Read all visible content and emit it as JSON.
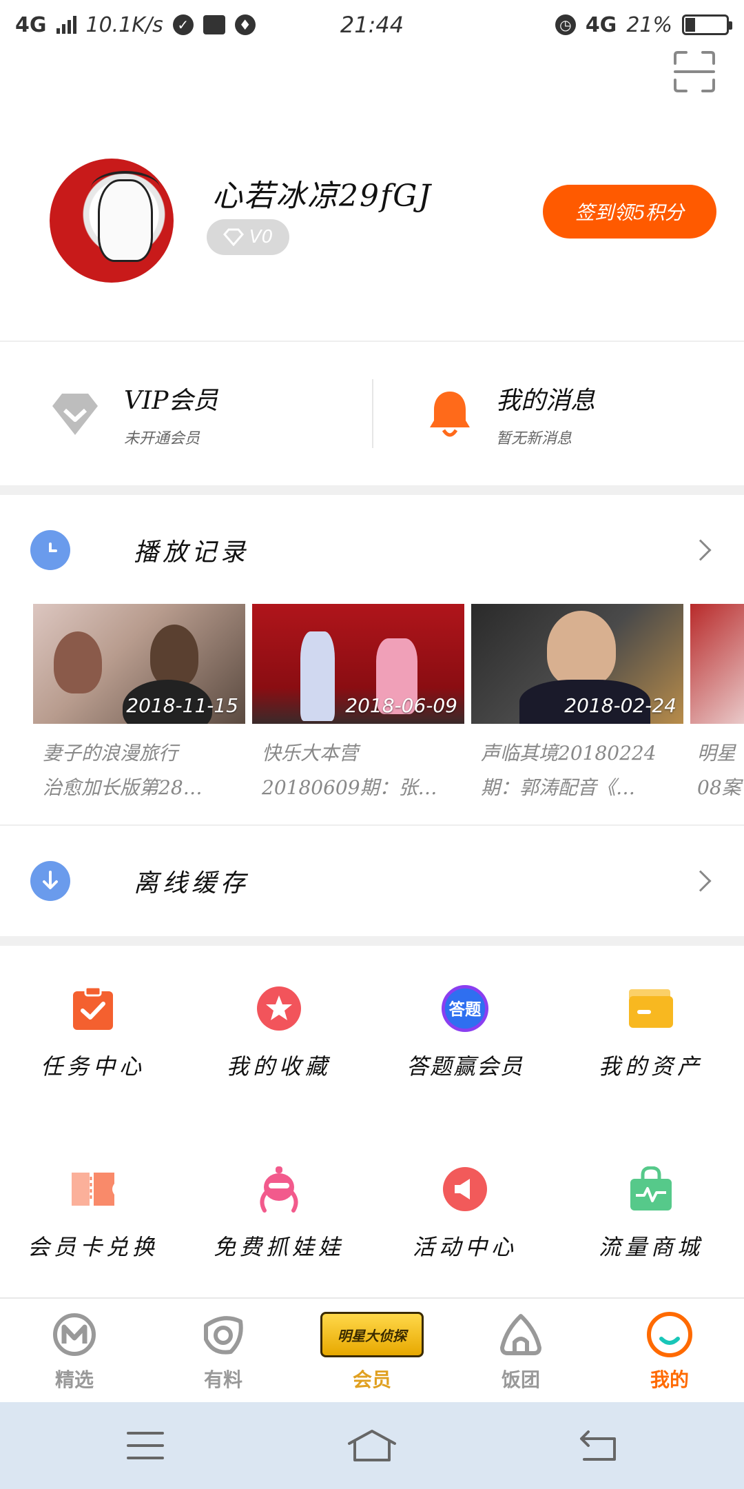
{
  "status_bar": {
    "network_left": "4G",
    "speed": "10.1K/s",
    "time": "21:44",
    "network_right": "4G",
    "battery": "21%"
  },
  "profile": {
    "username": "心若冰凉29fGJ",
    "vip_level": "V0",
    "checkin_label": "签到领5积分"
  },
  "vip": {
    "title": "VIP会员",
    "subtitle": "未开通会员"
  },
  "messages": {
    "title": "我的消息",
    "subtitle": "暂无新消息"
  },
  "history": {
    "label": "播放记录",
    "items": [
      {
        "date": "2018-11-15",
        "title1": "妻子的浪漫旅行",
        "title2": "治愈加长版第28…"
      },
      {
        "date": "2018-06-09",
        "title1": "快乐大本营",
        "title2": "20180609期：张…"
      },
      {
        "date": "2018-02-24",
        "title1": "声临其境20180224",
        "title2": "期：郭涛配音《…"
      },
      {
        "date": "",
        "title1": "明星",
        "title2": "08案"
      }
    ]
  },
  "offline": {
    "label": "离线缓存"
  },
  "grid": [
    {
      "label": "任务中心",
      "icon": "task-icon",
      "color": "#f4602f"
    },
    {
      "label": "我的收藏",
      "icon": "star-icon",
      "color": "#f2545b"
    },
    {
      "label": "答题赢会员",
      "icon": "quiz-icon",
      "badge": "答题",
      "color": "#3d7bf0"
    },
    {
      "label": "我的资产",
      "icon": "wallet-icon",
      "color": "#f8b820"
    },
    {
      "label": "会员卡兑换",
      "icon": "ticket-icon",
      "color": "#f98a6a"
    },
    {
      "label": "免费抓娃娃",
      "icon": "claw-icon",
      "color": "#f25a8c"
    },
    {
      "label": "活动中心",
      "icon": "megaphone-icon",
      "color": "#f25a5a"
    },
    {
      "label": "流量商城",
      "icon": "shop-bag-icon",
      "color": "#56c98a"
    }
  ],
  "tabs": [
    {
      "label": "精选",
      "icon": "m-logo-icon"
    },
    {
      "label": "有料",
      "icon": "swirl-icon"
    },
    {
      "label": "会员",
      "icon": "show-badge-icon",
      "badge_text": "明星大侦探"
    },
    {
      "label": "饭团",
      "icon": "riceball-icon"
    },
    {
      "label": "我的",
      "icon": "smile-icon"
    }
  ],
  "colors": {
    "accent": "#ff5a00",
    "active_tab": "#ff6a00",
    "member_tab": "#e0a020",
    "row_icon": "#6a9bec"
  }
}
